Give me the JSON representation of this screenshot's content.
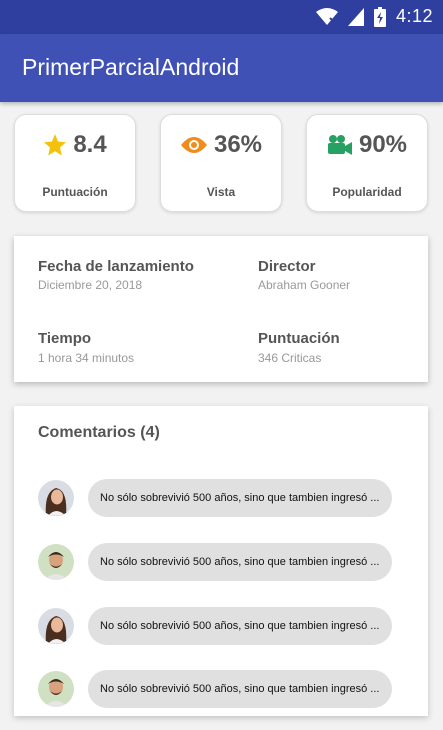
{
  "status_bar": {
    "time": "4:12",
    "icons": [
      "wifi-icon",
      "signal-icon",
      "battery-icon"
    ]
  },
  "app_bar": {
    "title": "PrimerParcialAndroid",
    "color": "#3f51b5"
  },
  "stats": [
    {
      "icon": "star-icon",
      "value": "8.4",
      "label": "Puntuación",
      "color": "#f4c20d"
    },
    {
      "icon": "eye-icon",
      "value": "36%",
      "label": "Vista",
      "color": "#f08c1a"
    },
    {
      "icon": "video-camera-icon",
      "value": "90%",
      "label": "Popularidad",
      "color": "#27a064"
    }
  ],
  "details": [
    {
      "label": "Fecha de lanzamiento",
      "value": "Diciembre 20, 2018"
    },
    {
      "label": "Director",
      "value": "Abraham Gooner"
    },
    {
      "label": "Tiempo",
      "value": "1 hora 34 minutos"
    },
    {
      "label": "Puntuación",
      "value": "346 Criticas"
    }
  ],
  "comments": {
    "title": "Comentarios (4)",
    "items": [
      {
        "avatar": "woman-avatar",
        "text": "No sólo sobrevivió 500 años, sino que tambien ingresó ..."
      },
      {
        "avatar": "man-avatar",
        "text": "No sólo sobrevivió 500 años, sino que tambien ingresó ..."
      },
      {
        "avatar": "woman-avatar",
        "text": "No sólo sobrevivió 500 años, sino que tambien ingresó ..."
      },
      {
        "avatar": "man-avatar",
        "text": "No sólo sobrevivió 500 años, sino que tambien ingresó ..."
      }
    ]
  }
}
